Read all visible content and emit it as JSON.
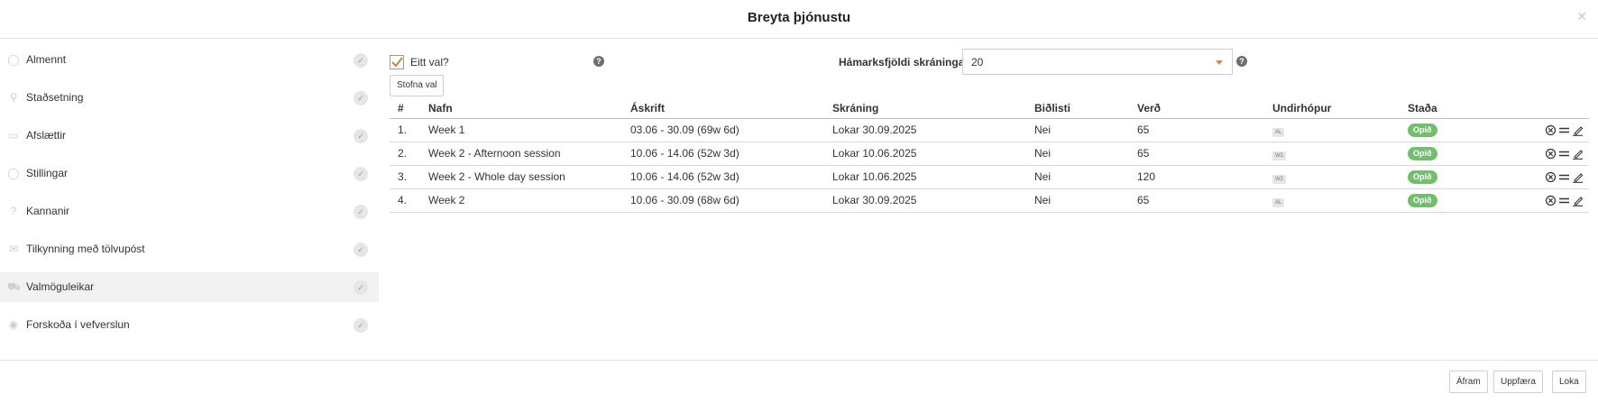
{
  "header": {
    "title": "Breyta þjónustu"
  },
  "sidebar": {
    "items": [
      {
        "label": "Almennt",
        "icon": "tag-icon",
        "glyph": "◯",
        "active": false
      },
      {
        "label": "Staðsetning",
        "icon": "location-pin-icon",
        "glyph": "⚲",
        "active": false
      },
      {
        "label": "Afslættir",
        "icon": "discount-icon",
        "glyph": "▭",
        "active": false
      },
      {
        "label": "Stillingar",
        "icon": "settings-icon",
        "glyph": "◯",
        "active": false
      },
      {
        "label": "Kannanir",
        "icon": "question-icon",
        "glyph": "?",
        "active": false
      },
      {
        "label": "Tilkynning með tölvupóst",
        "icon": "envelope-icon",
        "glyph": "✉",
        "active": false
      },
      {
        "label": "Valmöguleikar",
        "icon": "cart-icon",
        "glyph": "⛟",
        "active": true
      },
      {
        "label": "Forskoða í vefverslun",
        "icon": "eye-icon",
        "glyph": "◉",
        "active": false
      }
    ]
  },
  "main": {
    "single_choice_label": "Eitt val?",
    "single_choice_checked": true,
    "max_registrations_label": "Hámarksfjöldi skráninga",
    "max_registrations_value": "20",
    "help_glyph": "?",
    "create_button": "Stofna val",
    "columns": [
      "#",
      "Nafn",
      "Áskrift",
      "Skráning",
      "Biðlisti",
      "Verð",
      "Undirhópur",
      "Staða"
    ],
    "rows": [
      {
        "num": "1.",
        "name": "Week 1",
        "subscription": "03.06 - 30.09 (69w 6d)",
        "registration": "Lokar 30.09.2025",
        "waitlist": "Nei",
        "price": "65",
        "subgroup": "AL",
        "status": "Opið"
      },
      {
        "num": "2.",
        "name": "Week 2 - Afternoon session",
        "subscription": "10.06 - 14.06 (52w 3d)",
        "registration": "Lokar 10.06.2025",
        "waitlist": "Nei",
        "price": "65",
        "subgroup": "W2",
        "status": "Opið"
      },
      {
        "num": "3.",
        "name": "Week 2 - Whole day session",
        "subscription": "10.06 - 14.06 (52w 3d)",
        "registration": "Lokar 10.06.2025",
        "waitlist": "Nei",
        "price": "120",
        "subgroup": "W2",
        "status": "Opið"
      },
      {
        "num": "4.",
        "name": "Week 2",
        "subscription": "10.06 - 30.09 (68w 6d)",
        "registration": "Lokar 30.09.2025",
        "waitlist": "Nei",
        "price": "65",
        "subgroup": "AL",
        "status": "Opið"
      }
    ]
  },
  "footer": {
    "continue_label": "Áfram",
    "update_label": "Uppfæra",
    "close_label": "Loka"
  },
  "colors": {
    "status_open": "#6fbf6b",
    "select_caret": "#d58a45",
    "active_row": "#f2f2f2"
  }
}
